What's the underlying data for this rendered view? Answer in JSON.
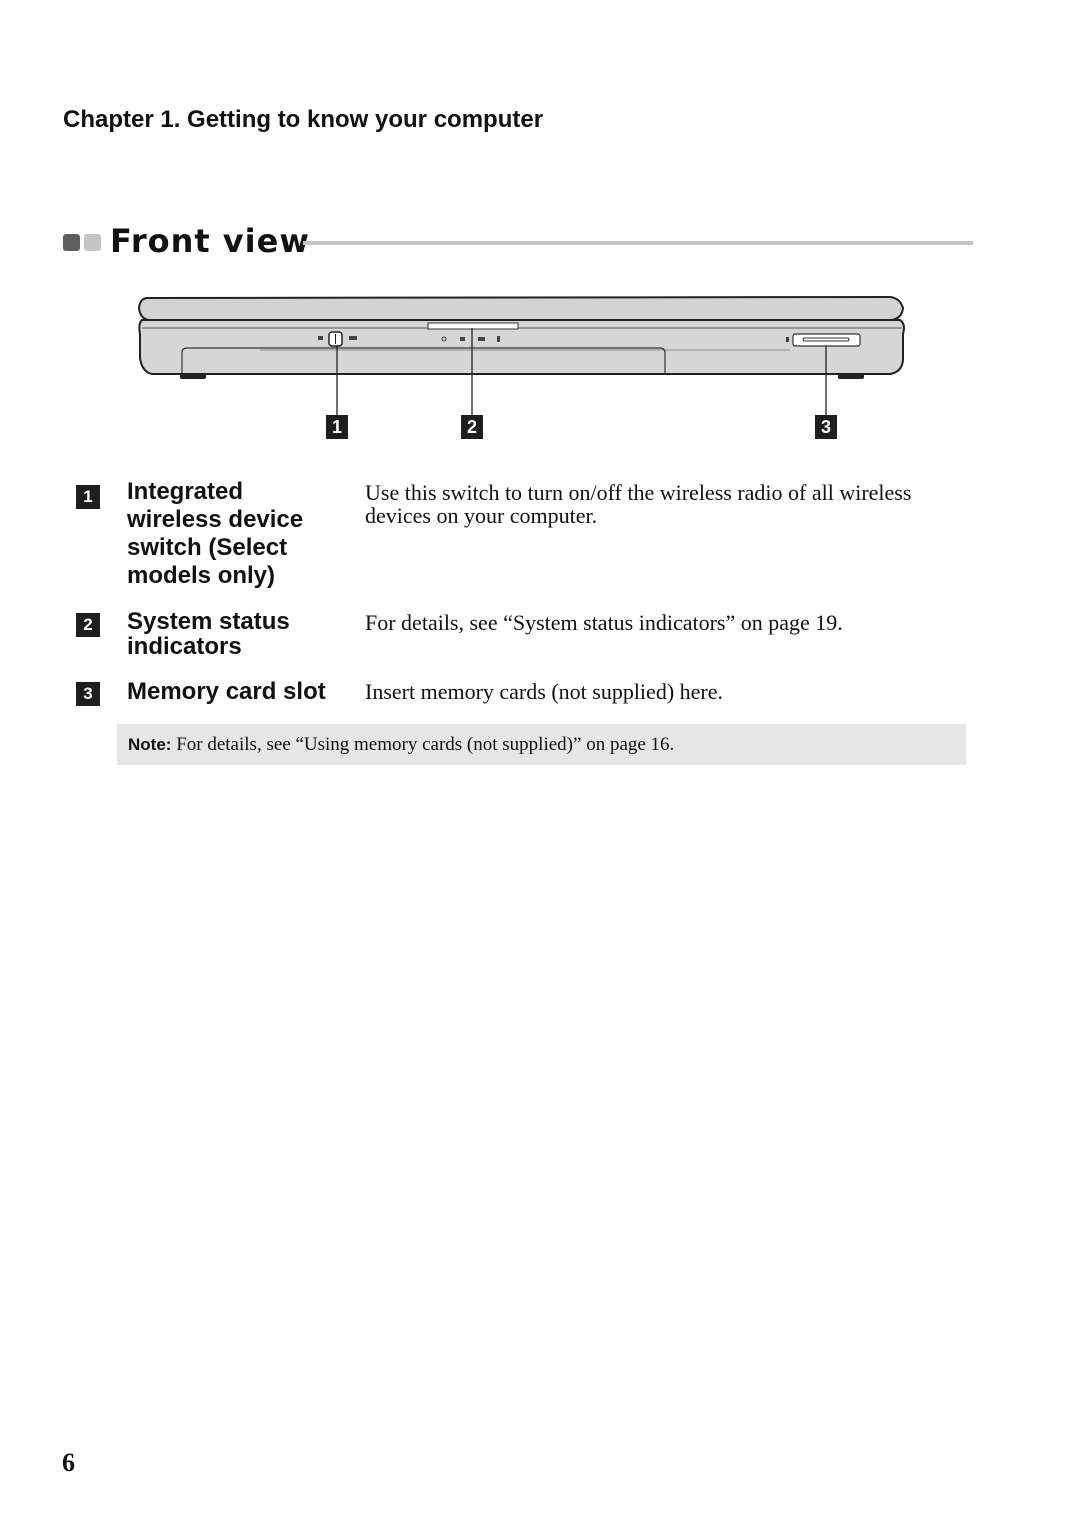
{
  "header": {
    "chapter": "Chapter 1. Getting to know your computer"
  },
  "section": {
    "title": "Front view"
  },
  "figure": {
    "callouts": [
      "1",
      "2",
      "3"
    ]
  },
  "items": [
    {
      "number": "1",
      "term": "Integrated wireless device switch (Select models only)",
      "description": "Use this switch to turn on/off the wireless radio of all wireless devices on your computer."
    },
    {
      "number": "2",
      "term": "System status indicators",
      "description": "For details, see “System status indicators” on page 19."
    },
    {
      "number": "3",
      "term": "Memory card slot",
      "description": "Insert memory cards (not supplied) here."
    }
  ],
  "note": {
    "label": "Note:",
    "text": " For details, see “Using memory cards (not supplied)” on page 16."
  },
  "footer": {
    "page_number": "6"
  }
}
